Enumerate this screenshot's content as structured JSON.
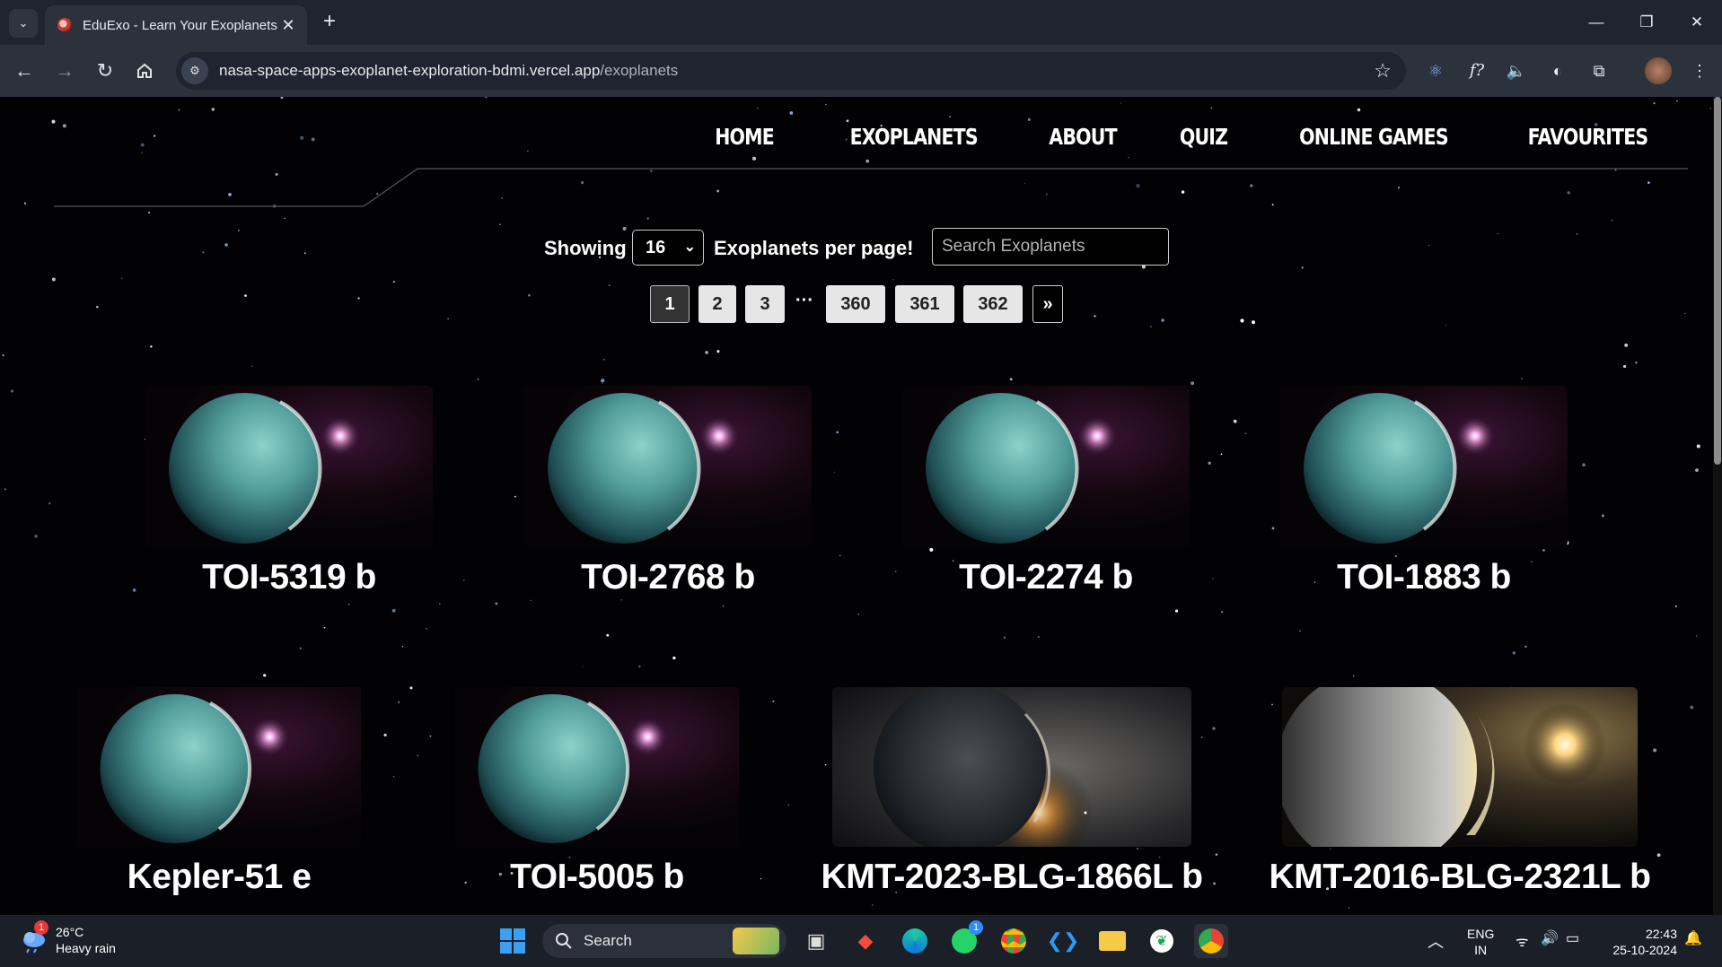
{
  "browser": {
    "tab_title": "EduExo - Learn Your Exoplanets",
    "url_host": "nasa-space-apps-exoplanet-exploration-bdmi.vercel.app",
    "url_path": "/exoplanets"
  },
  "site_nav": {
    "items": [
      "HOME",
      "EXOPLANETS",
      "ABOUT",
      "QUIZ",
      "ONLINE GAMES",
      "FAVOURITES"
    ]
  },
  "controls": {
    "showing_label": "Showing",
    "per_page_value": "16",
    "per_page_label": "Exoplanets per page!",
    "search_placeholder": "Search Exoplanets"
  },
  "pagination": {
    "pages": [
      "1",
      "2",
      "3",
      "360",
      "361",
      "362"
    ],
    "active_page": "1",
    "ellipsis": "···",
    "next_label": "»"
  },
  "exoplanets": [
    {
      "name": "TOI-5319 b",
      "image": "teal-planet"
    },
    {
      "name": "TOI-2768 b",
      "image": "teal-planet"
    },
    {
      "name": "TOI-2274 b",
      "image": "teal-planet"
    },
    {
      "name": "TOI-1883 b",
      "image": "teal-planet"
    },
    {
      "name": "Kepler-51 e",
      "image": "teal-planet"
    },
    {
      "name": "TOI-5005 b",
      "image": "teal-planet"
    },
    {
      "name": "KMT-2023-BLG-1866L b",
      "image": "rocky-planet"
    },
    {
      "name": "KMT-2016-BLG-2321L b",
      "image": "gas-giant"
    }
  ],
  "taskbar": {
    "weather_temp": "26°C",
    "weather_desc": "Heavy rain",
    "weather_badge": "1",
    "search_label": "Search",
    "whatsapp_badge": "1",
    "lang_line1": "ENG",
    "lang_line2": "IN",
    "time": "22:43",
    "date": "25-10-2024"
  },
  "colors": {
    "page_background": "#020204",
    "chrome_dark": "#1f252f",
    "chrome_toolbar": "#2c323c",
    "planet_teal": "#4f9a98",
    "star_glow": "#f2a8e6"
  }
}
